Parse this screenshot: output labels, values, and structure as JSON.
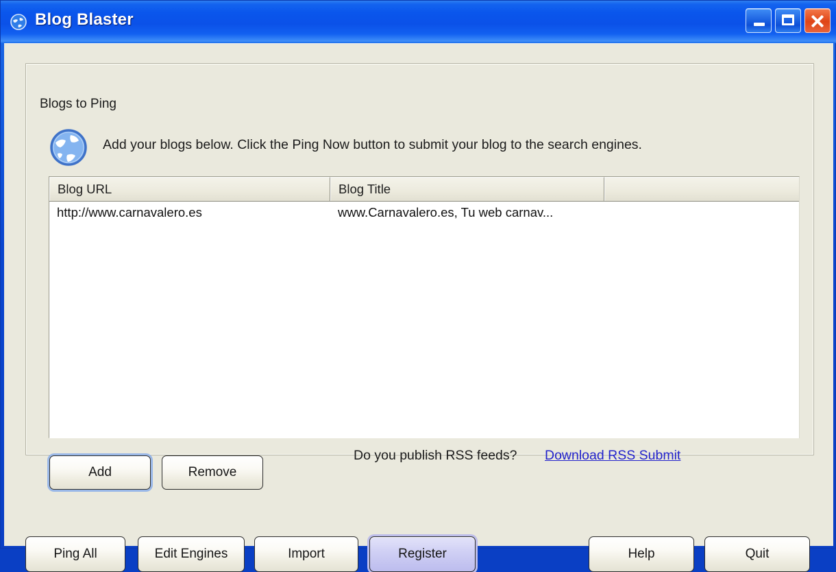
{
  "window": {
    "title": "Blog Blaster",
    "icon": "globe-icon",
    "controls": {
      "minimize": "Minimize",
      "maximize": "Maximize",
      "close": "Close"
    }
  },
  "group": {
    "legend": "Blogs to Ping",
    "icon": "globe-icon",
    "instruction": "Add your blogs below. Click the Ping Now button to submit your blog to the search engines."
  },
  "list": {
    "columns": [
      "Blog URL",
      "Blog Title",
      ""
    ],
    "rows": [
      {
        "url": "http://www.carnavalero.es",
        "title": "www.Carnavalero.es, Tu web carnav...",
        "extra": ""
      }
    ]
  },
  "rss": {
    "question": "Do you publish RSS feeds?",
    "link_label": "Download RSS Submit",
    "link_color": "#2222cc"
  },
  "list_buttons": {
    "add": "Add",
    "remove": "Remove"
  },
  "footer_buttons": {
    "ping_all": "Ping All",
    "edit_engines": "Edit Engines",
    "import": "Import",
    "register": "Register",
    "help": "Help",
    "quit": "Quit"
  },
  "colors": {
    "titlebar_blue": "#0b51e8",
    "window_frame": "#0a3fc4",
    "client_background": "#eae9dd",
    "register_accent": "#cfcff4",
    "close_button": "#df4416"
  }
}
